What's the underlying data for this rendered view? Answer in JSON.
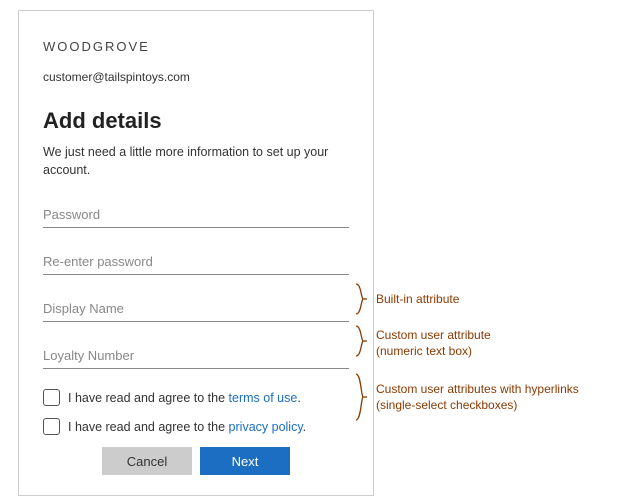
{
  "brand": "WOODGROVE",
  "email": "customer@tailspintoys.com",
  "heading": "Add details",
  "subtext": "We just need a little more information to set up your account.",
  "fields": {
    "password": {
      "placeholder": "Password",
      "value": ""
    },
    "repassword": {
      "placeholder": "Re-enter password",
      "value": ""
    },
    "displayname": {
      "placeholder": "Display Name",
      "value": ""
    },
    "loyalty": {
      "placeholder": "Loyalty Number",
      "value": ""
    }
  },
  "consents": {
    "prefix": "I have read and agree to the ",
    "terms_link": "terms of use",
    "privacy_link": "privacy policy",
    "period": "."
  },
  "buttons": {
    "cancel": "Cancel",
    "next": "Next"
  },
  "annotations": {
    "builtin": "Built-in attribute",
    "custom_numeric_l1": "Custom user attribute",
    "custom_numeric_l2": "(numeric text box)",
    "custom_checks_l1": "Custom user attributes with hyperlinks",
    "custom_checks_l2": "(single-select checkboxes)"
  }
}
